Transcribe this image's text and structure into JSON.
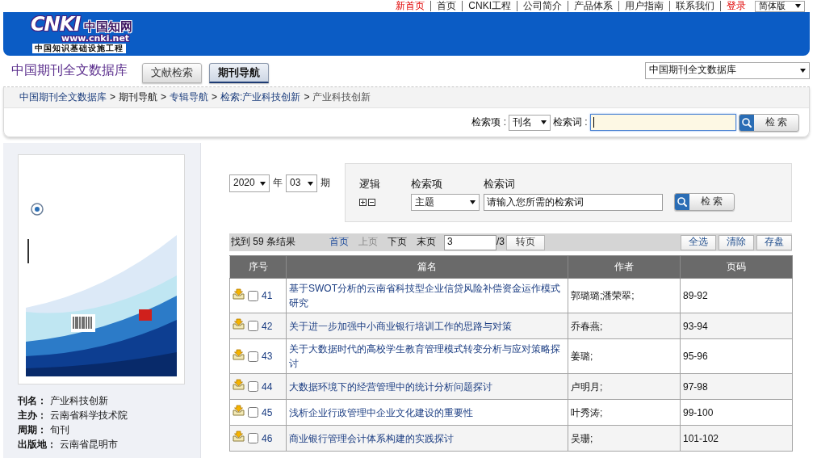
{
  "top_links": [
    {
      "label": "新首页",
      "highlight": true
    },
    {
      "label": "首页",
      "highlight": false
    },
    {
      "label": "CNKI工程",
      "highlight": false
    },
    {
      "label": "公司简介",
      "highlight": false
    },
    {
      "label": "产品体系",
      "highlight": false
    },
    {
      "label": "用户指南",
      "highlight": false
    },
    {
      "label": "联系我们",
      "highlight": false
    },
    {
      "label": "登录",
      "highlight": true
    }
  ],
  "language_select": {
    "value": "简体版"
  },
  "logo": {
    "letters": "CNKI",
    "name": "中国知网",
    "url": "www.cnki.net",
    "tagline": "中国知识基础设施工程"
  },
  "database_title": "中国期刊全文数据库",
  "tabs": [
    {
      "label": "文献检索",
      "selected": false
    },
    {
      "label": "期刊导航",
      "selected": true
    }
  ],
  "database_select": {
    "value": "中国期刊全文数据库"
  },
  "breadcrumb": {
    "items": [
      {
        "label": "中国期刊全文数据库",
        "kind": "link"
      },
      {
        "separator": ">",
        "label": "期刊导航",
        "kind": "plain"
      },
      {
        "separator": ">",
        "label": "专辑导航",
        "kind": "link"
      },
      {
        "separator": ">",
        "label": "检索:产业科技创新",
        "kind": "link"
      },
      {
        "separator": ">",
        "label": "产业科技创新",
        "kind": "current"
      }
    ]
  },
  "quick_search": {
    "field_label": "检索项 :",
    "field_value": "刊名",
    "term_label": "检索词 :",
    "focused": true,
    "button": "检 索"
  },
  "journal": {
    "info": [
      {
        "label": "刊名：",
        "value": "产业科技创新"
      },
      {
        "label": "主办：",
        "value": "云南省科学技术院"
      },
      {
        "label": "周期：",
        "value": "旬刊"
      },
      {
        "label": "出版地：",
        "value": "云南省昆明市"
      }
    ]
  },
  "issue": {
    "year": "2020",
    "year_unit": "年",
    "number": "03",
    "number_unit": "期"
  },
  "advanced_search": {
    "logic_label": "逻辑",
    "field_label": "检索项",
    "term_label": "检索词",
    "field_value": "主题",
    "term_value": "请输入您所需的检索词",
    "button": "检 索"
  },
  "results": {
    "summary": "找到 59 条结果",
    "pager": [
      {
        "label": "首页",
        "kind": "link"
      },
      {
        "label": "上页",
        "kind": "disabled"
      },
      {
        "label": "下页",
        "kind": "plain"
      },
      {
        "label": "末页",
        "kind": "plain"
      }
    ],
    "page_value": "3",
    "page_total": "/3",
    "go_button": "转页",
    "actions": [
      "全选",
      "清除",
      "存盘"
    ]
  },
  "table": {
    "columns": [
      "序号",
      "篇名",
      "作者",
      "页码"
    ],
    "rows": [
      {
        "number": "41",
        "checked": false,
        "title": "基于SWOT分析的云南省科技型企业信贷风险补偿资金运作模式研究",
        "authors": "郭璐璐;潘荣翠;",
        "pages": "89-92"
      },
      {
        "number": "42",
        "checked": false,
        "title": "关于进一步加强中小商业银行培训工作的思路与对策",
        "authors": "乔春燕;",
        "pages": "93-94"
      },
      {
        "number": "43",
        "checked": false,
        "title": "关于大数据时代的高校学生教育管理模式转变分析与应对策略探讨",
        "authors": "姜璐;",
        "pages": "95-96"
      },
      {
        "number": "44",
        "checked": false,
        "title": "大数据环境下的经营管理中的统计分析问题探讨",
        "authors": "卢明月;",
        "pages": "97-98"
      },
      {
        "number": "45",
        "checked": false,
        "title": "浅析企业行政管理中企业文化建设的重要性",
        "authors": "叶秀涛;",
        "pages": "99-100"
      },
      {
        "number": "46",
        "checked": false,
        "title": "商业银行管理会计体系构建的实践探讨",
        "authors": "吴珊;",
        "pages": "101-102"
      }
    ]
  }
}
